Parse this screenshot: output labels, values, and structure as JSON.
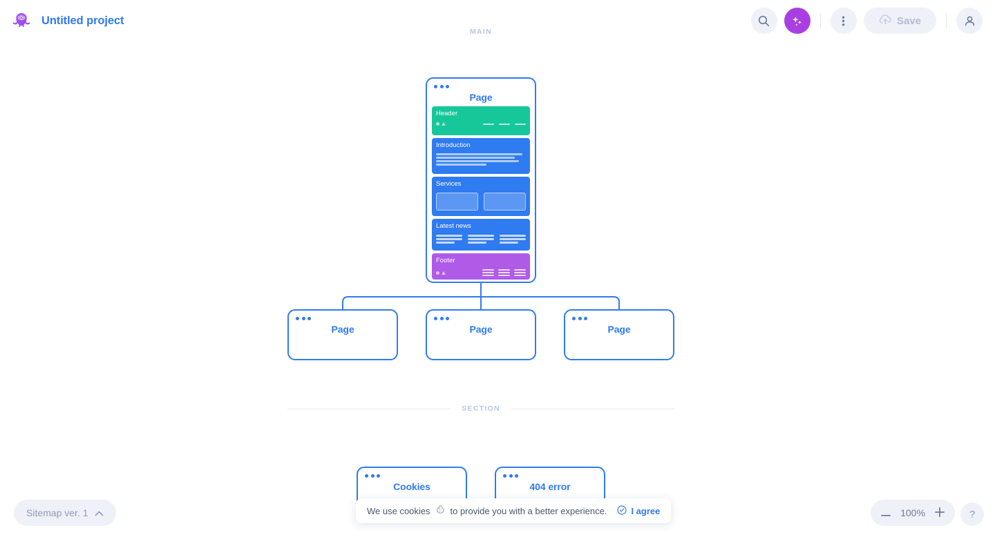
{
  "header": {
    "logo_icon": "octopus-logo-icon",
    "project_title": "Untitled project",
    "search_icon": "search-icon",
    "ai_icon": "sparkle-icon",
    "more_icon": "three-dot-vertical-icon",
    "save_label": "Save",
    "save_icon": "cloud-upload-icon",
    "account_icon": "user-icon"
  },
  "canvas": {
    "main_label": "MAIN",
    "section_label": "SECTION",
    "card_menu_icon": "three-dot-icon"
  },
  "main_page": {
    "title": "Page",
    "blocks": [
      {
        "name": "Header",
        "color": "#16c79a",
        "kind": "header"
      },
      {
        "name": "Introduction",
        "color": "#2f7bf0",
        "kind": "text"
      },
      {
        "name": "Services",
        "color": "#2f7bf0",
        "kind": "boxes"
      },
      {
        "name": "Latest news",
        "color": "#2f7bf0",
        "kind": "columns"
      },
      {
        "name": "Footer",
        "color": "#b05ae8",
        "kind": "footer"
      }
    ]
  },
  "child_pages": [
    {
      "title": "Page"
    },
    {
      "title": "Page"
    },
    {
      "title": "Page"
    }
  ],
  "section_pages": [
    {
      "title": "Cookies"
    },
    {
      "title": "404 error"
    }
  ],
  "footer_bar": {
    "sitemap_label": "Sitemap ver. 1",
    "sitemap_chevron_icon": "chevron-up-icon",
    "zoom_out_icon": "minus-icon",
    "zoom_value": "100%",
    "zoom_in_icon": "plus-icon",
    "help_label": "?"
  },
  "cookie_banner": {
    "text_before": "We use cookies",
    "cookie_icon": "cookie-icon",
    "text_after": "to provide you with a better experience.",
    "check_icon": "check-circle-icon",
    "agree_label": "I agree"
  },
  "colors": {
    "brand_blue": "#2f7bf0",
    "ai_purple": "#a93fe0",
    "teal": "#16c79a",
    "footer_purple": "#b05ae8",
    "muted": "#b9c6e4",
    "chip_bg": "#eef1f8"
  }
}
